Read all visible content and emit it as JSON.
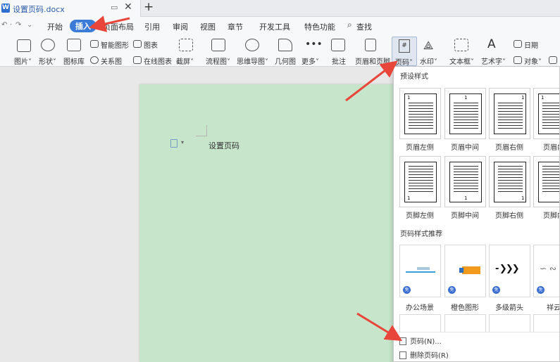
{
  "tab": {
    "title": "设置页码.docx",
    "logo": "W"
  },
  "quick": [
    "↶",
    "·",
    "↷",
    "⌄"
  ],
  "menu": {
    "items": [
      "开始",
      "插入",
      "页面布局",
      "引用",
      "审阅",
      "视图",
      "章节",
      "开发工具",
      "特色功能"
    ],
    "search": "查找",
    "active": "插入"
  },
  "ribbon": {
    "picture": "图片˅",
    "shape": "形状˅",
    "iconlib": "图标库",
    "smart": "智能图形",
    "chart": "图表",
    "relation": "关系图",
    "online_chart": "在线图表",
    "screenshot": "截屏˅",
    "flowchart": "流程图˅",
    "mindmap": "思维导图˅",
    "geometry": "几何图",
    "more": "更多˅",
    "comment": "批注",
    "header_footer": "页眉和页脚",
    "page_number": "页码˅",
    "watermark": "水印˅",
    "textbox": "文本框˅",
    "wordart": "艺术字˅",
    "date": "日期",
    "object": "对象˅",
    "page_number_glyph": "#"
  },
  "document": {
    "text": "设置页码"
  },
  "dropdown": {
    "preset_heading": "预设样式",
    "preset_row1": [
      "页眉左侧",
      "页眉中间",
      "页眉右侧",
      "页眉内"
    ],
    "preset_row2": [
      "页脚左侧",
      "页脚中间",
      "页脚右侧",
      "页脚内"
    ],
    "thumb_number": "1",
    "recommend_heading": "页码样式推荐",
    "recommend": [
      "办公场景",
      "橙色图形",
      "多级箭头",
      "祥云"
    ],
    "free_badge": "免",
    "cmd_page_number": "页码(N)...",
    "cmd_delete": "删除页码(R)"
  },
  "colors": {
    "accent": "#3b7bd8",
    "annotation_arrow": "#e8463a",
    "page_bg": "#c7e5cb"
  }
}
